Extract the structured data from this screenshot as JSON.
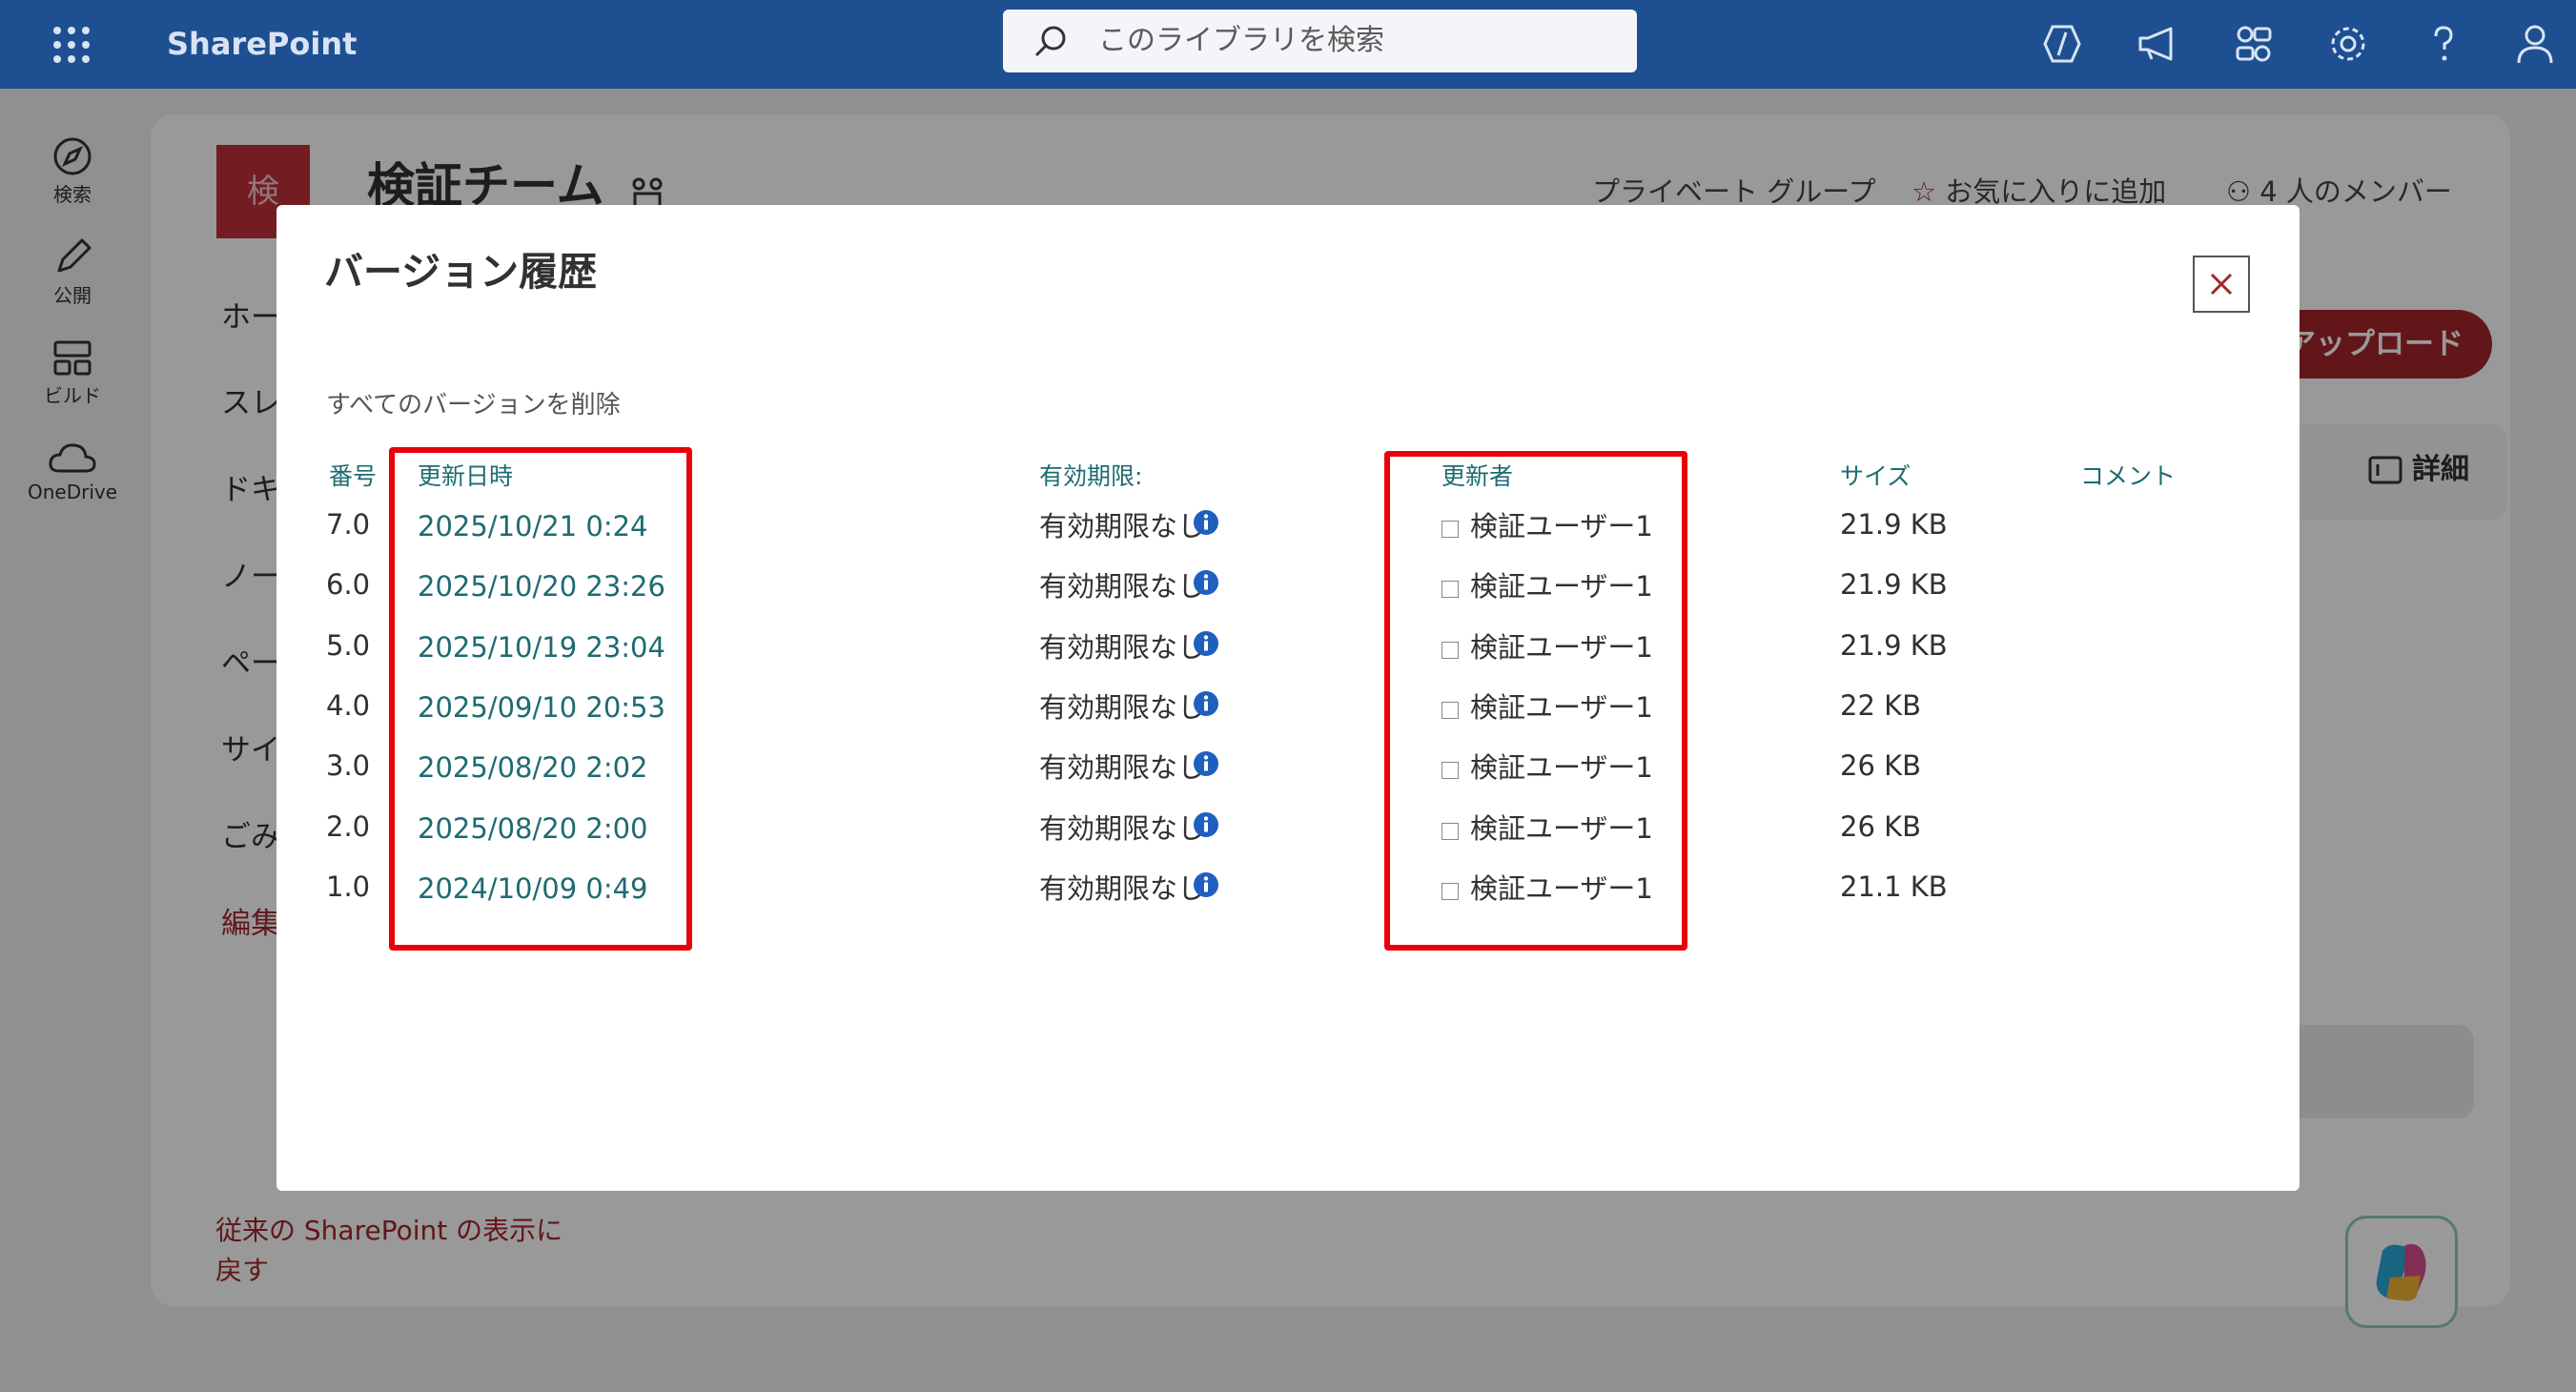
{
  "topbar": {
    "brand": "SharePoint",
    "search_placeholder": "このライブラリを検索",
    "icons": [
      "app-launcher-icon",
      "search-icon",
      "copilot-icon",
      "megaphone-icon",
      "share-network-icon",
      "settings-icon",
      "help-icon",
      "account-icon"
    ]
  },
  "rail": {
    "items": [
      {
        "label": "検索",
        "icon": "compass-icon"
      },
      {
        "label": "公開",
        "icon": "pencil-icon"
      },
      {
        "label": "ビルド",
        "icon": "layout-icon"
      },
      {
        "label": "OneDrive",
        "icon": "cloud-icon"
      }
    ]
  },
  "site": {
    "logo_letter": "検",
    "title": "検証チーム",
    "privacy": "プライベート グループ",
    "favorite": "お気に入りに追加",
    "members": "4 人のメンバー",
    "nav": [
      "ホー",
      "スレ",
      "ドキ",
      "ノー",
      "ペー",
      "サイ",
      "ごみ",
      "編集"
    ],
    "upload": "アップロード",
    "details": "詳細",
    "classic_link": "従来の SharePoint の表示に戻す"
  },
  "dialog": {
    "title": "バージョン履歴",
    "delete_all": "すべてのバージョンを削除",
    "columns": {
      "number": "番号",
      "modified": "更新日時",
      "expires": "有効期限:",
      "modified_by": "更新者",
      "size": "サイズ",
      "comment": "コメント"
    },
    "rows": [
      {
        "version": "7.0",
        "date": "2025/10/21 0:24",
        "expires": "有効期限なし",
        "user": "検証ユーザー1",
        "size": "21.9 KB"
      },
      {
        "version": "6.0",
        "date": "2025/10/20 23:26",
        "expires": "有効期限なし",
        "user": "検証ユーザー1",
        "size": "21.9 KB"
      },
      {
        "version": "5.0",
        "date": "2025/10/19 23:04",
        "expires": "有効期限なし",
        "user": "検証ユーザー1",
        "size": "21.9 KB"
      },
      {
        "version": "4.0",
        "date": "2025/09/10 20:53",
        "expires": "有効期限なし",
        "user": "検証ユーザー1",
        "size": "22 KB"
      },
      {
        "version": "3.0",
        "date": "2025/08/20 2:02",
        "expires": "有効期限なし",
        "user": "検証ユーザー1",
        "size": "26 KB"
      },
      {
        "version": "2.0",
        "date": "2025/08/20 2:00",
        "expires": "有効期限なし",
        "user": "検証ユーザー1",
        "size": "26 KB"
      },
      {
        "version": "1.0",
        "date": "2024/10/09 0:49",
        "expires": "有効期限なし",
        "user": "検証ユーザー1",
        "size": "21.1 KB"
      }
    ]
  },
  "colors": {
    "suite_bar": "#1e4f91",
    "accent_red": "#a4262c",
    "link_teal": "#1e6b72",
    "highlight": "#e8000b"
  }
}
